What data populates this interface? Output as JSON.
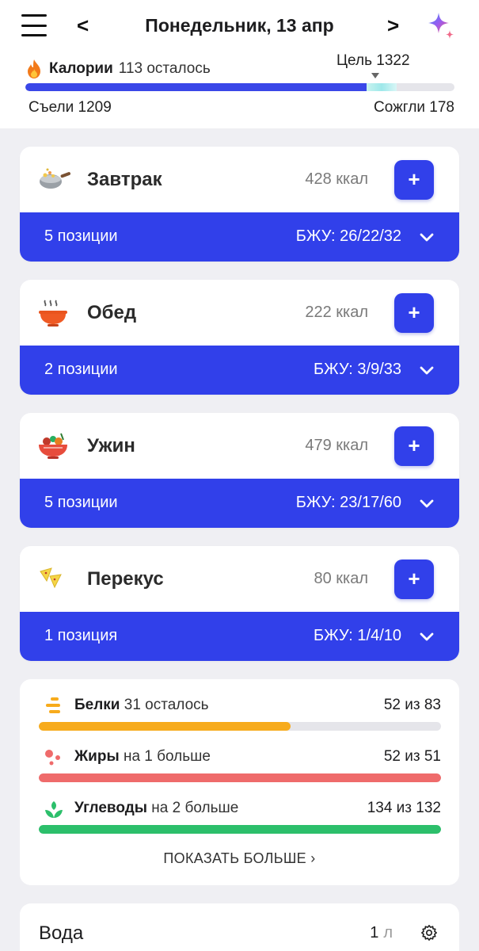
{
  "header": {
    "date_title": "Понедельник, 13 апр",
    "prev_glyph": "<",
    "next_glyph": ">",
    "menu_icon": "hamburger-icon",
    "assistant_icon": "sparkle-icon"
  },
  "calories": {
    "label": "Калории",
    "remaining_text": "113 осталось",
    "goal_text": "Цель 1322",
    "eaten_text": "Съели 1209",
    "burned_text": "Сожгли 178",
    "goal": 1322,
    "eaten": 1209,
    "burned": 178,
    "icon": "flame-icon",
    "fill_color": "#3a47e8"
  },
  "meals": [
    {
      "name": "Завтрак",
      "kcal": "428 ккал",
      "add_label": "+",
      "count": "5 позиции",
      "macros": "БЖУ: 26/22/32",
      "icon": "wok-icon"
    },
    {
      "name": "Обед",
      "kcal": "222 ккал",
      "add_label": "+",
      "count": "2 позиции",
      "macros": "БЖУ: 3/9/33",
      "icon": "soup-bowl-icon"
    },
    {
      "name": "Ужин",
      "kcal": "479 ккал",
      "add_label": "+",
      "count": "5 позиции",
      "macros": "БЖУ: 23/17/60",
      "icon": "salad-bowl-icon"
    },
    {
      "name": "Перекус",
      "kcal": "80 ккал",
      "add_label": "+",
      "count": "1 позиция",
      "macros": "БЖУ: 1/4/10",
      "icon": "nachos-icon"
    }
  ],
  "macros": [
    {
      "name": "Белки",
      "note": "31 осталось",
      "value": "52 из 83",
      "current": 52,
      "target": 83,
      "color": "#f7ab1c",
      "icon": "protein-bars-icon"
    },
    {
      "name": "Жиры",
      "note": "на 1 больше",
      "value": "52 из 51",
      "current": 52,
      "target": 51,
      "color": "#ef6b6b",
      "icon": "fat-dots-icon"
    },
    {
      "name": "Углеводы",
      "note": "на 2 больше",
      "value": "134 из 132",
      "current": 134,
      "target": 132,
      "color": "#2cbf6b",
      "icon": "carbs-leaf-icon"
    }
  ],
  "show_more": "ПОКАЗАТЬ БОЛЬШЕ ›",
  "water": {
    "title": "Вода",
    "amount": "1",
    "unit": "л",
    "icon": "gear-icon"
  },
  "colors": {
    "accent": "#3140ea",
    "background": "#efeff3"
  }
}
